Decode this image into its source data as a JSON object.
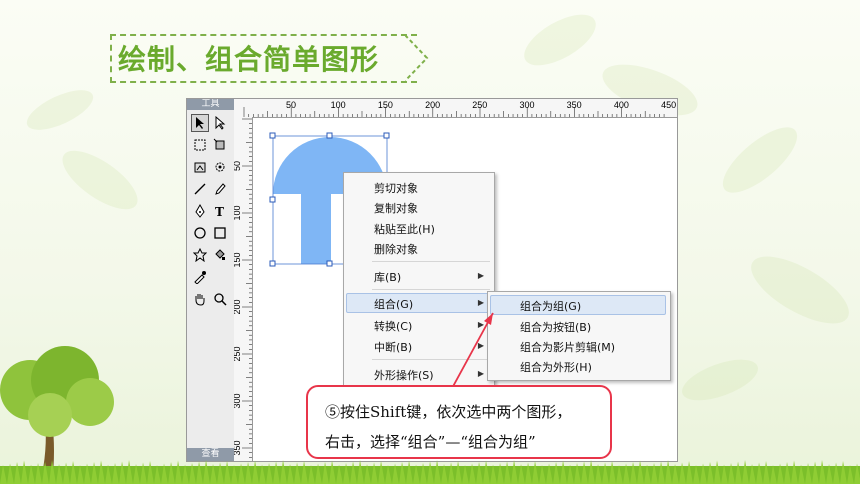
{
  "title": "绘制、组合简单图形",
  "toolbox": {
    "header": "工具",
    "footer": "查看"
  },
  "ruler": {
    "top_labels": [
      "50",
      "100",
      "150",
      "200",
      "250",
      "300",
      "350",
      "400",
      "450"
    ],
    "left_labels": [
      "50",
      "100",
      "150",
      "200",
      "250",
      "300",
      "350"
    ]
  },
  "context_menu": {
    "items": [
      {
        "label": "剪切对象"
      },
      {
        "label": "复制对象"
      },
      {
        "label": "粘贴至此(H)"
      },
      {
        "label": "删除对象"
      },
      {
        "label": "库(B)"
      },
      {
        "label": "组合(G)"
      },
      {
        "label": "转换(C)"
      },
      {
        "label": "中断(B)"
      },
      {
        "label": "外形操作(S)"
      }
    ]
  },
  "submenu": {
    "items": [
      {
        "label": "组合为组(G)"
      },
      {
        "label": "组合为按钮(B)"
      },
      {
        "label": "组合为影片剪辑(M)"
      },
      {
        "label": "组合为外形(H)"
      }
    ]
  },
  "callout": {
    "line1": "⑤按住Shift键，依次选中两个图形，",
    "line2": "右击，选择“组合”—“组合为组”"
  },
  "colors": {
    "title_green": "#6aaa2d",
    "shape_blue": "#7fb6f5",
    "callout_red": "#e8354a"
  }
}
